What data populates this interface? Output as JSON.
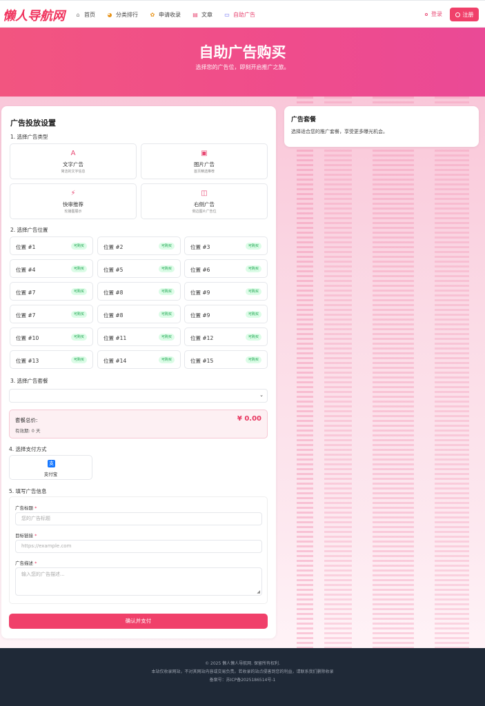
{
  "logo": "懒人导航网",
  "nav": {
    "items": [
      {
        "label": "首页",
        "icon": "home-icon",
        "glyph": "⌂",
        "color": "#777"
      },
      {
        "label": "分类排行",
        "icon": "pie-chart-icon",
        "glyph": "◕",
        "color": "#e8941a"
      },
      {
        "label": "申请收录",
        "icon": "cat-icon",
        "glyph": "✿",
        "color": "#e8941a"
      },
      {
        "label": "文章",
        "icon": "document-icon",
        "glyph": "▤",
        "color": "#e84a74"
      },
      {
        "label": "自助广告",
        "icon": "card-icon",
        "glyph": "▭",
        "color": "#6366f1"
      }
    ],
    "login": "登录",
    "register": "注册"
  },
  "hero": {
    "title": "自助广告购买",
    "subtitle": "选择您的广告位，即刻开启推广之旅。"
  },
  "form": {
    "title": "广告投放设置",
    "step1": "1. 选择广告类型",
    "types": [
      {
        "name": "文字广告",
        "desc": "简洁的文字信息",
        "icon": "text-icon",
        "glyph": "A"
      },
      {
        "name": "图片广告",
        "desc": "首页精选推荐",
        "icon": "image-icon",
        "glyph": "▣"
      },
      {
        "name": "快审推荐",
        "desc": "轮播图展示",
        "icon": "lightning-icon",
        "glyph": "⚡"
      },
      {
        "name": "右侧广告",
        "desc": "侧边图片广告位",
        "icon": "gift-icon",
        "glyph": "◫"
      }
    ],
    "step2": "2. 选择广告位置",
    "badge": "可购买",
    "positions": [
      "位置 #1",
      "位置 #2",
      "位置 #3",
      "位置 #4",
      "位置 #5",
      "位置 #6",
      "位置 #7",
      "位置 #8",
      "位置 #9",
      "位置 #7",
      "位置 #8",
      "位置 #9",
      "位置 #10",
      "位置 #11",
      "位置 #12",
      "位置 #13",
      "位置 #14",
      "位置 #15"
    ],
    "step3": "3. 选择广告套餐",
    "select_value": "",
    "total_label": "套餐总价:",
    "total_price": "¥ 0.00",
    "validity": "有效期: 0 天",
    "step4": "4. 选择支付方式",
    "pay_method": "支付宝",
    "pay_glyph": "支",
    "step5": "5. 填写广告信息",
    "field_title_label": "广告标题",
    "field_title_placeholder": "您的广告标题",
    "field_link_label": "目标链接",
    "field_link_placeholder": "https://example.com",
    "field_desc_label": "广告描述",
    "field_desc_placeholder": "输入您的广告描述...",
    "required_mark": "*",
    "confirm": "确认并支付"
  },
  "side": {
    "title": "广告套餐",
    "desc": "选择适合您的推广套餐，享受更多曝光机会。"
  },
  "footer": {
    "line1": "© 2025 懒人懒人导航网. 保留所有权利.",
    "line2": "本站仅收录网站，不对其网站内容或交易负责。若收录的站点侵害到您的利益，请联系我们删除收录",
    "line3": "备案号：苏ICP备2025186514号-1"
  },
  "colors": {
    "accent": "#f0406a",
    "available": "#16a34a"
  }
}
